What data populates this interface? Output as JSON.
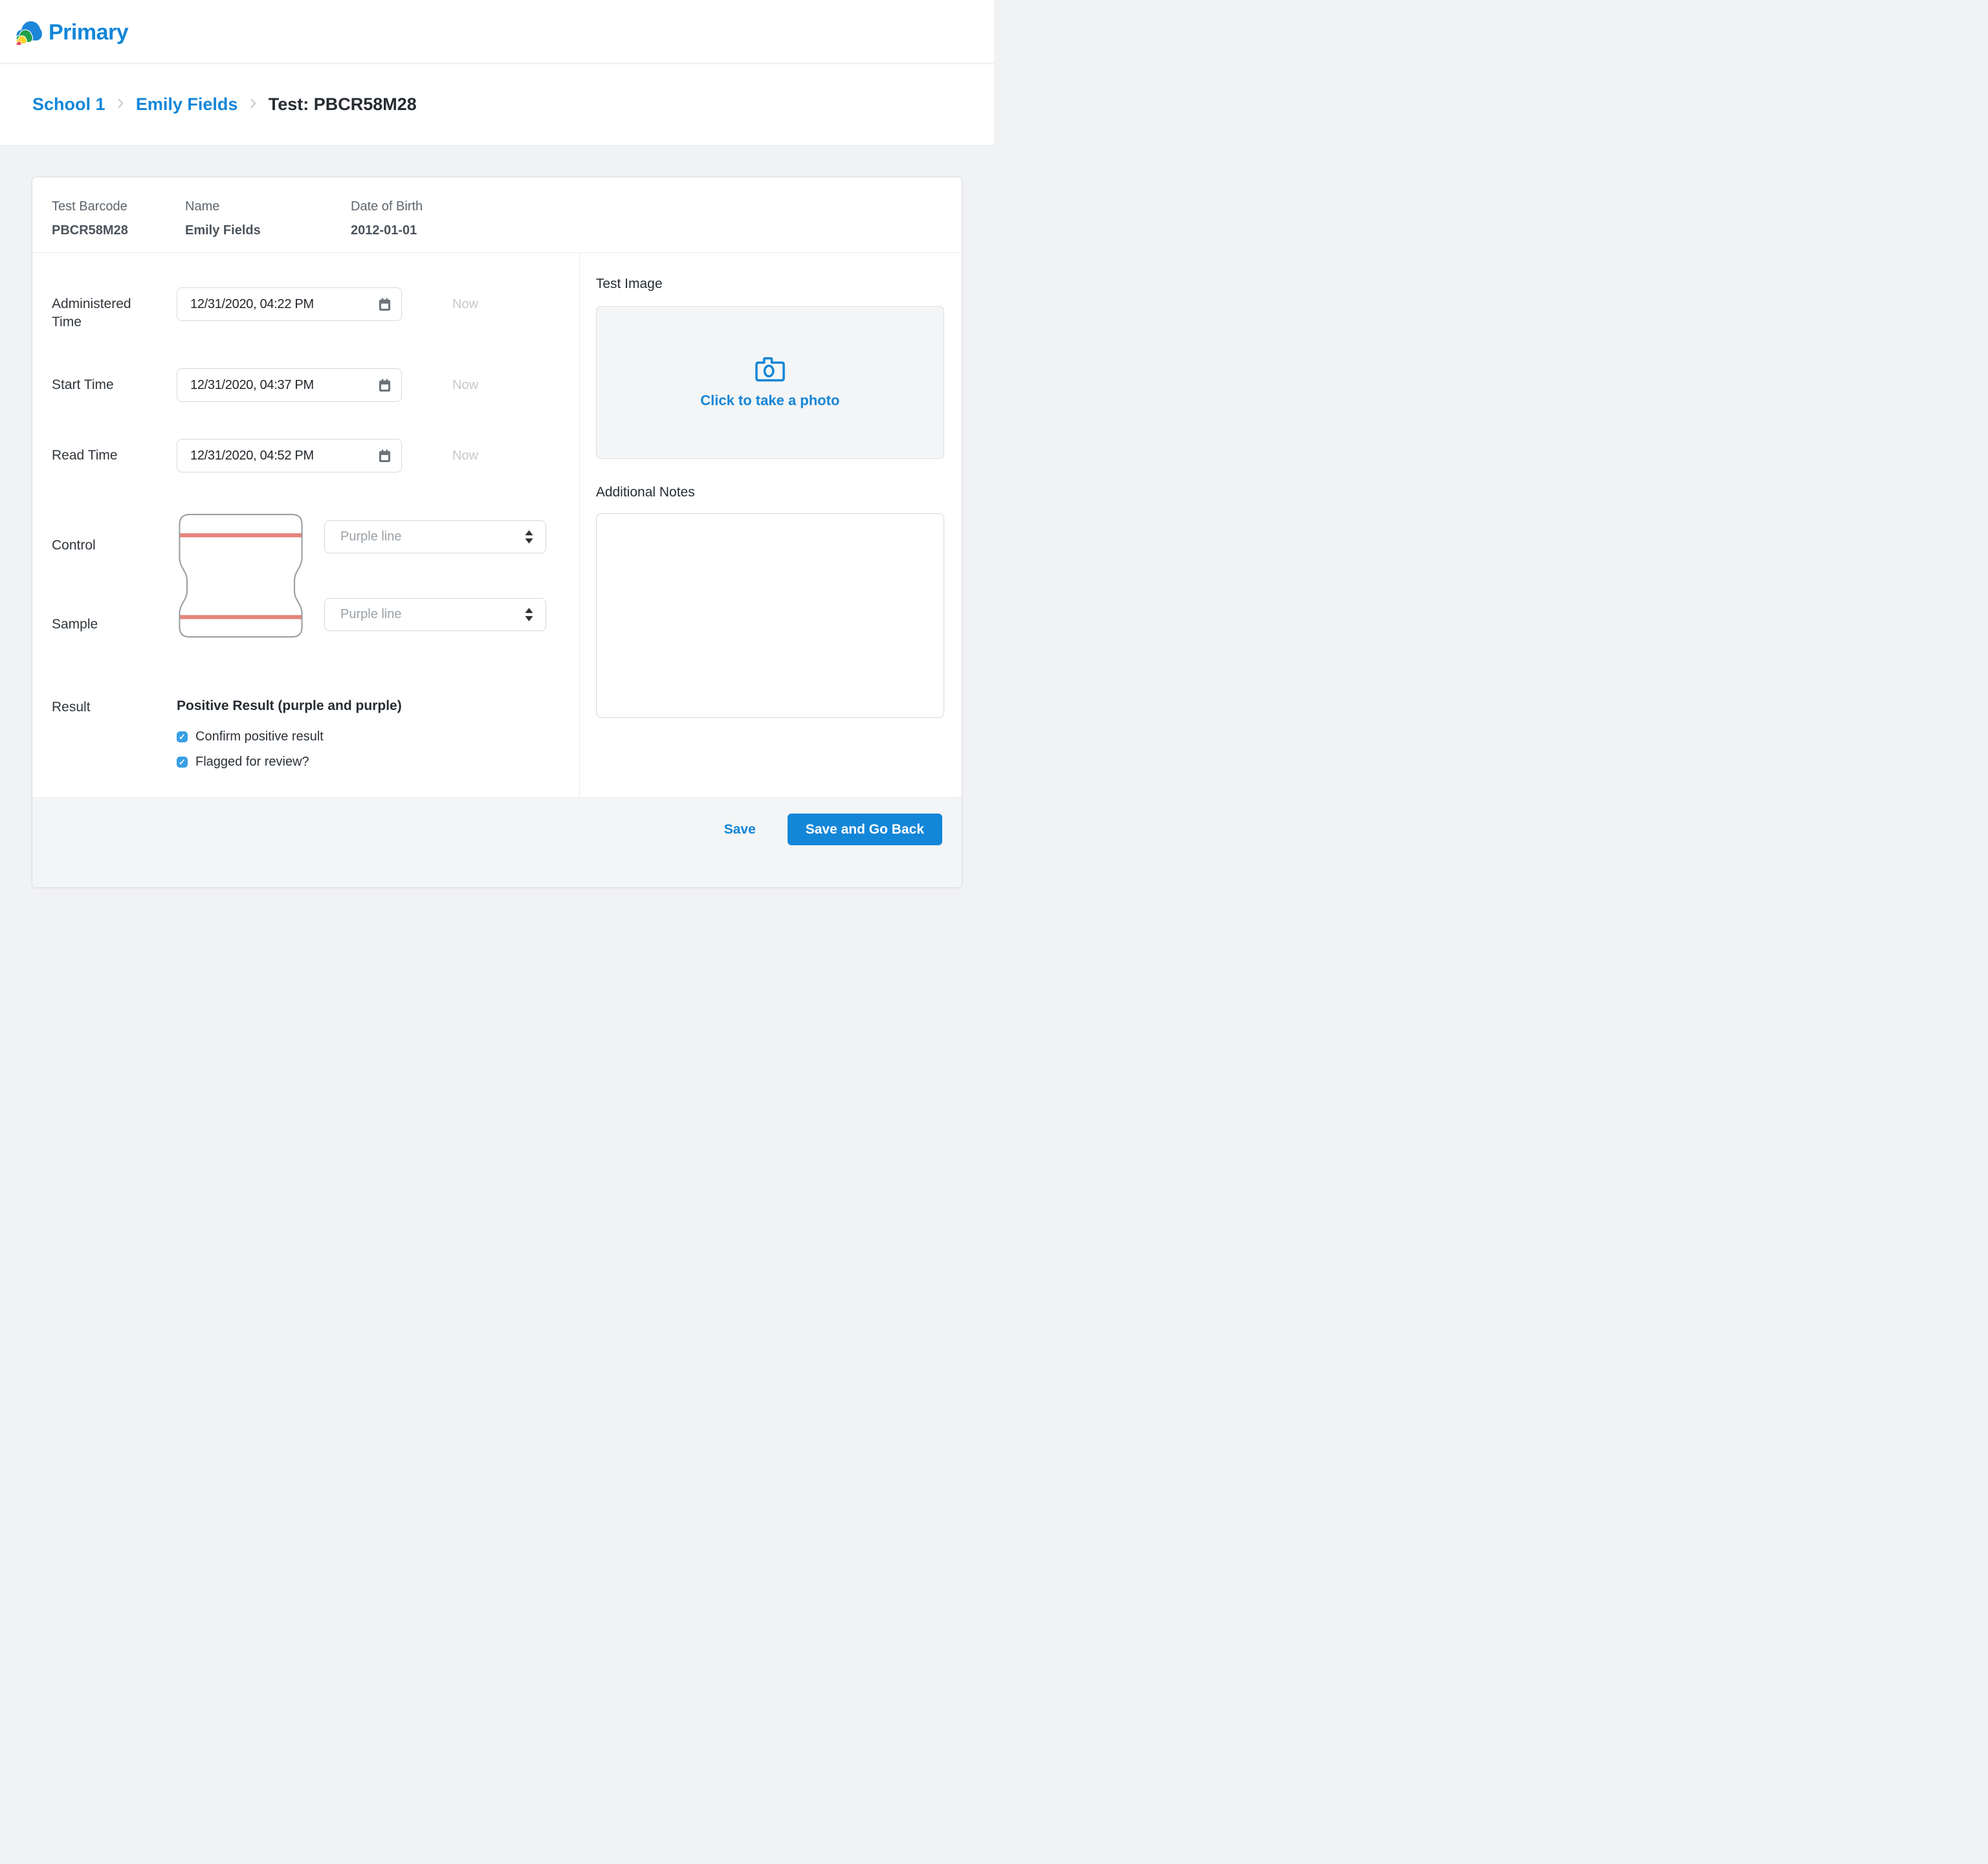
{
  "header": {
    "logo_text": "Primary"
  },
  "breadcrumb": {
    "separator": "›",
    "items": [
      {
        "label": "School 1"
      },
      {
        "label": "Emily Fields"
      }
    ],
    "current": "Test: PBCR58M28"
  },
  "patient_info": {
    "fields": [
      {
        "label": "Test Barcode",
        "value": "PBCR58M28"
      },
      {
        "label": "Name",
        "value": "Emily Fields"
      },
      {
        "label": "Date of Birth",
        "value": "2012-01-01"
      }
    ]
  },
  "form": {
    "time_fields": [
      {
        "label": "Administered Time",
        "value": "12/31/2020, 04:22 PM",
        "now_label": "Now"
      },
      {
        "label": "Start Time",
        "value": "12/31/2020, 04:37 PM",
        "now_label": "Now"
      },
      {
        "label": "Read Time",
        "value": "12/31/2020, 04:52 PM",
        "now_label": "Now"
      }
    ],
    "lines": {
      "control_label": "Control",
      "sample_label": "Sample",
      "control_value": "Purple line",
      "sample_value": "Purple line"
    },
    "result": {
      "label": "Result",
      "text": "Positive Result (purple and purple)",
      "checkboxes": [
        {
          "label": "Confirm positive result",
          "checked": true
        },
        {
          "label": "Flagged for review?",
          "checked": true
        }
      ]
    }
  },
  "right_panel": {
    "test_image": {
      "title": "Test Image",
      "cta": "Click to take a photo"
    },
    "notes": {
      "title": "Additional Notes",
      "value": ""
    }
  },
  "footer": {
    "save_label": "Save",
    "save_go_back_label": "Save and Go Back"
  },
  "icons": {
    "check": "✓"
  },
  "colors": {
    "accent": "#1386d8",
    "checkbox_blue": "#379fe6",
    "cassette_line": "#e5837b",
    "cassette_outline": "#9aa0a5",
    "logo_blue": "#1d86d8",
    "logo_green": "#1fa04a",
    "logo_yellow": "#fdd22b",
    "logo_red": "#ef4050",
    "page_background": "#f1f2f3",
    "footer_background": "#f4f5f6"
  }
}
